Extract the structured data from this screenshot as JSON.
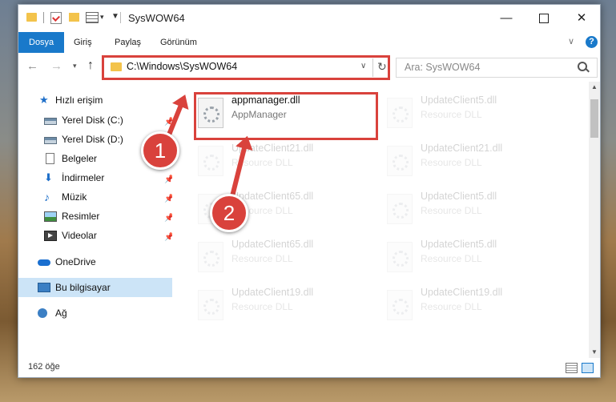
{
  "window": {
    "title": "SysWOW64"
  },
  "ribbon": {
    "tabs": [
      "Dosya",
      "Giriş",
      "Paylaş",
      "Görünüm"
    ]
  },
  "address": {
    "path": "C:\\Windows\\SysWOW64"
  },
  "search": {
    "placeholder": "Ara: SysWOW64"
  },
  "sidebar": {
    "quick_access": "Hızlı erişim",
    "items": [
      {
        "label": "Yerel Disk (C:)",
        "icon": "drive-icon",
        "pinned": true
      },
      {
        "label": "Yerel Disk (D:)",
        "icon": "drive-icon",
        "pinned": true
      },
      {
        "label": "Belgeler",
        "icon": "documents-icon",
        "pinned": true
      },
      {
        "label": "İndirmeler",
        "icon": "downloads-icon",
        "pinned": true
      },
      {
        "label": "Müzik",
        "icon": "music-icon",
        "pinned": true
      },
      {
        "label": "Resimler",
        "icon": "pictures-icon",
        "pinned": true
      },
      {
        "label": "Videolar",
        "icon": "videos-icon",
        "pinned": true
      }
    ],
    "onedrive": "OneDrive",
    "this_pc": "Bu bilgisayar",
    "network": "Ağ"
  },
  "files": [
    {
      "name": "appmanager.dll",
      "desc": "AppManager"
    },
    {
      "name": "UpdateClient5.dll",
      "desc": "Resource DLL"
    },
    {
      "name": "UpdateClient21.dll",
      "desc": "Resource DLL"
    },
    {
      "name": "UpdateClient21.dll",
      "desc": "Resource DLL"
    },
    {
      "name": "UpdateClient65.dll",
      "desc": "Resource DLL"
    },
    {
      "name": "UpdateClient5.dll",
      "desc": "Resource DLL"
    },
    {
      "name": "UpdateClient65.dll",
      "desc": "Resource DLL"
    },
    {
      "name": "UpdateClient5.dll",
      "desc": "Resource DLL"
    },
    {
      "name": "UpdateClient19.dll",
      "desc": "Resource DLL"
    },
    {
      "name": "UpdateClient19.dll",
      "desc": "Resource DLL"
    }
  ],
  "status": {
    "count": "162 öğe"
  },
  "annotations": {
    "step1": "1",
    "step2": "2"
  },
  "colors": {
    "accent": "#1979ca",
    "highlight": "#d9423c",
    "selection": "#cce4f7"
  }
}
